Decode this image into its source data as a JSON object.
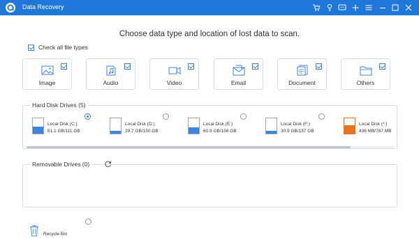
{
  "window": {
    "title": "Data Recovery",
    "controls": [
      "cart-icon",
      "key-icon",
      "chat-icon",
      "plus-icon",
      "menu-icon",
      "minimize-icon",
      "maximize-icon",
      "close-icon"
    ]
  },
  "main": {
    "heading": "Choose data type and location of lost data to scan.",
    "check_all_label": "Check all file types"
  },
  "file_types": [
    {
      "label": "Image",
      "icon": "image-icon",
      "checked": true
    },
    {
      "label": "Audio",
      "icon": "audio-icon",
      "checked": true
    },
    {
      "label": "Video",
      "icon": "video-icon",
      "checked": true
    },
    {
      "label": "Email",
      "icon": "email-icon",
      "checked": true
    },
    {
      "label": "Document",
      "icon": "document-icon",
      "checked": true
    },
    {
      "label": "Others",
      "icon": "folder-icon",
      "checked": true
    }
  ],
  "hard_disk": {
    "title": "Hard Disk Drives (5)",
    "drives": [
      {
        "name": "Local Disk (C:)",
        "size": "51.1 GB/111 GB",
        "used_fraction": 0.46,
        "selected": true,
        "color": "#3b86e0"
      },
      {
        "name": "Local Disk (D:)",
        "size": "29.7 GB/150 GB",
        "used_fraction": 0.2,
        "selected": false,
        "color": "#3b86e0"
      },
      {
        "name": "Local Disk (E:)",
        "size": "60.9 GB/158 GB",
        "used_fraction": 0.39,
        "selected": false,
        "color": "#3b86e0"
      },
      {
        "name": "Local Disk (F:)",
        "size": "30.9 GB/157 GB",
        "used_fraction": 0.2,
        "selected": false,
        "color": "#3b86e0"
      },
      {
        "name": "Local Disk (*:)",
        "size": "436 MB/787 MB",
        "used_fraction": 0.55,
        "selected": false,
        "color": "#e8731f"
      }
    ]
  },
  "removable": {
    "title": "Removable Drives (0)"
  },
  "recycle_bin": {
    "label": "Recycle Bin",
    "selected": false
  },
  "colors": {
    "titlebar": "#1f78d9",
    "accent": "#3a7fd4",
    "drive_fill": "#3b86e0",
    "drive_fill_alt": "#e8731f"
  }
}
